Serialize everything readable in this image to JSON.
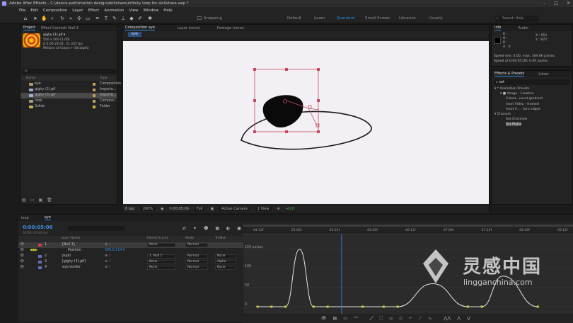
{
  "window": {
    "title": "Adobe After Effects - C:\\dance path\\motion design\\skillshare\\infinity loop for skillshare.aep *",
    "controls": [
      "–",
      "□",
      "✕"
    ]
  },
  "menu": [
    "File",
    "Edit",
    "Composition",
    "Layer",
    "Effect",
    "Animation",
    "View",
    "Window",
    "Help"
  ],
  "toolbar": {
    "snapping_label": "Snapping",
    "workspaces": [
      "Default",
      "Learn",
      "Standard",
      "Small Screen",
      "Libraries",
      "Usually"
    ],
    "active_workspace": "Standard",
    "search_placeholder": "Search Help"
  },
  "project_panel": {
    "tabs": [
      "Project",
      "Effect Controls Null 1"
    ],
    "selected_name": "gighy (3).gif ▾",
    "selected_info": [
      "500 x 500 (1.00)",
      "Δ 0:00:24:01, 31.333 fps",
      "Millions of Colors+ (Straight)"
    ],
    "search_placeholder": "ρ·",
    "columns": [
      "Name",
      "Type"
    ],
    "items": [
      {
        "name": "eye",
        "type": "Composition",
        "color": "#b0a070"
      },
      {
        "name": "gighy (2).gif",
        "type": "Importe...",
        "color": "#a0b0d0"
      },
      {
        "name": "gighy (3).gif",
        "type": "Importe...",
        "color": "#a0b0d0"
      },
      {
        "name": "loop",
        "type": "Composi...",
        "color": "#b0a070"
      },
      {
        "name": "Solids",
        "type": "Folder",
        "color": "#c8b050"
      }
    ],
    "selected_index": 2
  },
  "composition_panel": {
    "tabs": [
      "Composition eye",
      "Layer (none)",
      "Footage (none)"
    ],
    "comp_tab": "eye",
    "footer": {
      "bit_depth": "8 bpc",
      "zoom": "200%",
      "timecode": "0:00:05:06",
      "resolution": "Full",
      "camera": "Active Camera",
      "views": "1 View",
      "exposure": "+0.0"
    }
  },
  "info_panel": {
    "tabs": [
      "Info",
      "Audio"
    ],
    "channels": [
      "R :",
      "G :",
      "B :",
      "A : 0"
    ],
    "coords": [
      "X : 551",
      "Y : 872"
    ],
    "speed_lines": [
      "Speed min: 0.00, max: 164.66 px/sec",
      "Speed at 0:00:05:06: 0.00 px/sec"
    ]
  },
  "effects_panel": {
    "tabs": [
      "Effects & Presets",
      "Librar"
    ],
    "search_value": "set",
    "tree": [
      {
        "text": "▾ * Animation Presets",
        "indent": 0
      },
      {
        "text": "▾ ■ Image - Creative",
        "indent": 1
      },
      {
        "text": "Colors...uxset gradient",
        "indent": 2
      },
      {
        "text": "Inset Video - framed",
        "indent": 2
      },
      {
        "text": "Inset V... - torn edges",
        "indent": 2
      },
      {
        "text": "▾ Channel",
        "indent": 0
      },
      {
        "text": "Set Channels",
        "indent": 2
      },
      {
        "text": "Set Matte",
        "indent": 2,
        "highlight": true
      }
    ]
  },
  "timeline": {
    "tabs": [
      "loop",
      "eye"
    ],
    "active_tab": "eye",
    "timecode": "0:00:05:06",
    "fps_info": "00156 (30.00 fps)",
    "columns": [
      "Layer Name",
      "Parent & Link",
      "Mode",
      "TrkMat"
    ],
    "layers": [
      {
        "num": "1",
        "name": "[Null 1]",
        "color": "#d04040",
        "parent": "None",
        "mode": "Normal",
        "trkmat": "",
        "selected": true
      },
      {
        "num": "",
        "name": "Position",
        "color": "",
        "parent": "",
        "mode": "",
        "trkmat": "",
        "value": "309.0,114.0",
        "is_property": true
      },
      {
        "num": "2",
        "name": "pupil",
        "color": "#6070c0",
        "parent": "1. Null 1",
        "mode": "Normal",
        "trkmat": "None"
      },
      {
        "num": "3",
        "name": "[gighy (3).gif]",
        "color": "#6070c0",
        "parent": "None",
        "mode": "Normal",
        "trkmat": "Alpha"
      },
      {
        "num": "4",
        "name": "eye border",
        "color": "#6070c0",
        "parent": "None",
        "mode": "Normal",
        "trkmat": "None"
      }
    ],
    "ruler_ticks": [
      "04:12f",
      "05:00f",
      "05:12f",
      "06:00f",
      "06:12f",
      "07:00f",
      "07:12f",
      "08:00f",
      "08:12f"
    ],
    "graph_labels": [
      "150 px/sec",
      "100",
      "50",
      "0"
    ]
  },
  "graph_data": {
    "type": "line",
    "x": [
      4.0,
      4.2,
      4.4,
      4.6,
      4.8,
      5.0,
      5.5,
      5.8,
      6.0,
      6.5,
      7.0,
      7.2,
      7.5,
      8.0
    ],
    "y": [
      0,
      0,
      0,
      150,
      0,
      0,
      0,
      0,
      0,
      60,
      0,
      0,
      80,
      0
    ],
    "ylim": [
      0,
      170
    ],
    "ylabel": "px/sec"
  },
  "watermark": {
    "cn": "灵感中国",
    "url": "lingganchina.com"
  },
  "colors": {
    "accent": "#2d8ceb",
    "timecode": "#3d8ddd",
    "selection": "#c24a5c",
    "curve": "#e6e6e6",
    "keyframe": "#d6d23a"
  }
}
